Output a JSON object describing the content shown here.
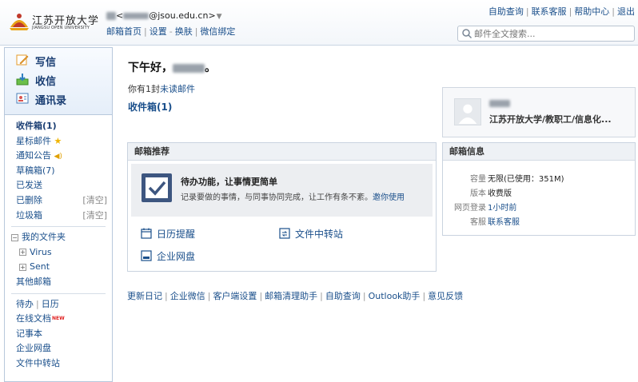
{
  "header": {
    "logo_cn": "江苏开放大学",
    "logo_en": "JIANGSU OPEN UNIVERSITY",
    "address_suffix": "@jsou.edu.cn>",
    "address_open": "<",
    "links": [
      "邮箱首页",
      "设置",
      "换肤",
      "微信绑定"
    ],
    "top_links": [
      "自助查询",
      "联系客服",
      "帮助中心",
      "退出"
    ],
    "search_placeholder": "邮件全文搜索..."
  },
  "sidebar": {
    "compose": "写信",
    "receive": "收信",
    "contacts": "通讯录",
    "folders": [
      {
        "label": "收件箱(1)"
      },
      {
        "label": "星标邮件"
      },
      {
        "label": "通知公告"
      },
      {
        "label": "草稿箱(7)"
      },
      {
        "label": "已发送"
      },
      {
        "label": "已删除",
        "action": "[清空]"
      },
      {
        "label": "垃圾箱",
        "action": "[清空]"
      }
    ],
    "my_folders": "我的文件夹",
    "subfolders": [
      "Virus",
      "Sent"
    ],
    "other_mail": "其他邮箱",
    "tools": {
      "todo": "待办",
      "calendar": "日历",
      "online_docs": "在线文档",
      "new_badge": "NEW",
      "notes": "记事本",
      "netdisk": "企业网盘",
      "transfer": "文件中转站"
    }
  },
  "main": {
    "greeting_prefix": "下午好，",
    "greeting_suffix": "。",
    "unread_prefix": "你有1封",
    "unread_link": "未读邮件",
    "inbox_title": "收件箱(1)",
    "recommend": {
      "title": "邮箱推荐",
      "promo_title": "待办功能，让事情更简单",
      "promo_desc": "记录要做的事情，与同事协同完成，让工作有条不紊。",
      "promo_link": "邀你使用",
      "features": [
        "日历提醒",
        "文件中转站",
        "企业网盘"
      ]
    },
    "bottom_links": [
      "更新日记",
      "企业微信",
      "客户端设置",
      "邮箱清理助手",
      "自助查询",
      "Outlook助手",
      "意见反馈"
    ]
  },
  "profile": {
    "org": "江苏开放大学/教职工/信息化..."
  },
  "mail_info": {
    "title": "邮箱信息",
    "rows": [
      {
        "key": "容量",
        "value": "无限(已使用：351M)"
      },
      {
        "key": "版本",
        "value": "收费版"
      },
      {
        "key": "网页登录",
        "value": "1小时前"
      },
      {
        "key": "客服",
        "value": "联系客服"
      }
    ]
  },
  "colors": {
    "link": "#1a4f8b",
    "sidebar_border": "#b8c8dc",
    "new_badge": "#e02020",
    "star": "#f0b400"
  }
}
